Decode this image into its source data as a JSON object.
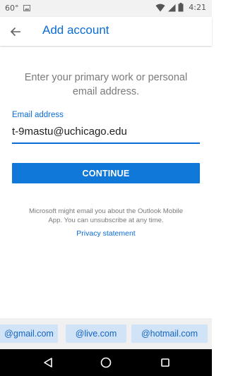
{
  "status_bar": {
    "temperature": "60°",
    "time": "4:21",
    "icons": [
      "image-icon",
      "wifi-icon",
      "signal-icon",
      "battery-icon"
    ]
  },
  "app_bar": {
    "title": "Add account",
    "back_icon": "arrow-left-icon"
  },
  "form": {
    "instruction": "Enter your primary work or personal email address.",
    "email_label": "Email address",
    "email_value": "t-9mastu@uchicago.edu",
    "continue_label": "CONTINUE"
  },
  "footer": {
    "disclaimer": "Microsoft might email you about the Outlook Mobile App. You can unsubscribe at any time.",
    "privacy_link": "Privacy statement"
  },
  "suggestions": [
    "@gmail.com",
    "@live.com",
    "@hotmail.com"
  ],
  "nav_bar": {
    "icons": [
      "back-triangle-icon",
      "home-circle-icon",
      "recents-square-icon"
    ]
  },
  "colors": {
    "accent": "#0a6cd6",
    "button": "#0f78d8",
    "chip_bg": "#d1e3f7",
    "muted_text": "#7a7a7a"
  }
}
